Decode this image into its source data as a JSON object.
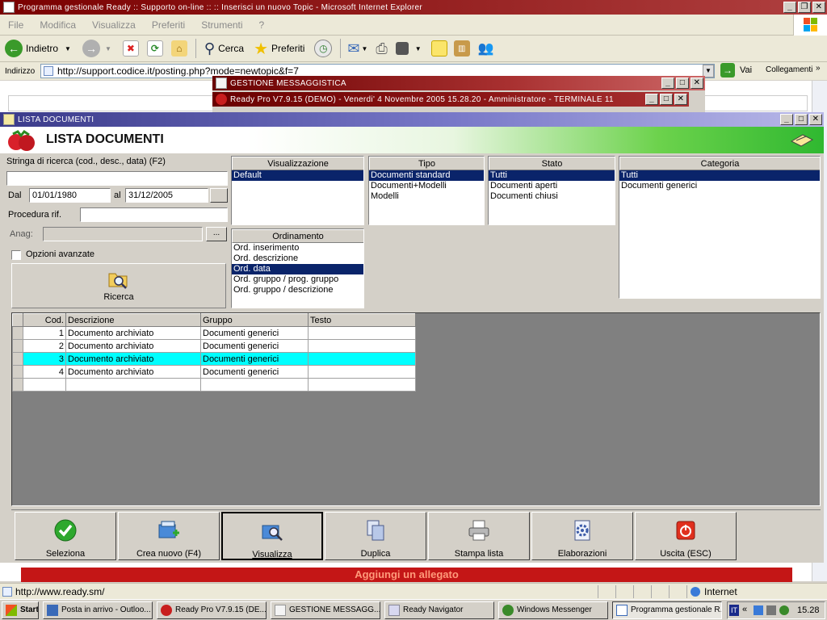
{
  "ie": {
    "title": "Programma gestionale Ready :: Supporto on-line :: :: Inserisci un nuovo Topic - Microsoft Internet Explorer",
    "menu": [
      "File",
      "Modifica",
      "Visualizza",
      "Preferiti",
      "Strumenti",
      "?"
    ],
    "toolbar": {
      "back": "Indietro",
      "search": "Cerca",
      "favorites": "Preferiti"
    },
    "address_label": "Indirizzo",
    "address_url": "http://support.codice.it/posting.php?mode=newtopic&f=7",
    "go_label": "Vai",
    "links_label": "Collegamenti",
    "page_banner": "Aggiungi un allegato",
    "status_url": "http://www.ready.sm/",
    "zone": "Internet"
  },
  "messaging": {
    "title": "GESTIONE MESSAGGISTICA",
    "subtitle": "Ready Pro V7.9.15 (DEMO)  - Venerdi' 4 Novembre 2005  15.28.20 - Amministratore - TERMINALE 11"
  },
  "app": {
    "window_title": "LISTA DOCUMENTI",
    "header_title": "LISTA DOCUMENTI",
    "search_label": "Stringa di ricerca (cod., desc., data) (F2)",
    "search_value": "",
    "dal_label": "Dal",
    "dal_value": "01/01/1980",
    "al_label": "al",
    "al_value": "31/12/2005",
    "procedura_label": "Procedura rif.",
    "procedura_value": "",
    "anag_label": "Anag:",
    "anag_button": "...",
    "advanced_label": "Opzioni avanzate",
    "advanced_checked": false,
    "search_button": "Ricerca",
    "panels": {
      "visualizzazione": {
        "title": "Visualizzazione",
        "items": [
          "Default"
        ],
        "selected": 0
      },
      "tipo": {
        "title": "Tipo",
        "items": [
          "Documenti standard",
          "Documenti+Modelli",
          "Modelli"
        ],
        "selected": 0
      },
      "stato": {
        "title": "Stato",
        "items": [
          "Tutti",
          "Documenti aperti",
          "Documenti chiusi"
        ],
        "selected": 0
      },
      "categoria": {
        "title": "Categoria",
        "items": [
          "Tutti",
          "Documenti generici"
        ],
        "selected": 0
      },
      "ordinamento": {
        "title": "Ordinamento",
        "items": [
          "Ord. inserimento",
          "Ord. descrizione",
          "Ord. data",
          "Ord. gruppo / prog. gruppo",
          "Ord. gruppo / descrizione"
        ],
        "selected": 2
      }
    },
    "grid": {
      "columns": [
        "Cod.",
        "Descrizione",
        "Gruppo",
        "Testo"
      ],
      "rows": [
        [
          "1",
          "Documento archiviato",
          "Documenti generici",
          ""
        ],
        [
          "2",
          "Documento archiviato",
          "Documenti generici",
          ""
        ],
        [
          "3",
          "Documento archiviato",
          "Documenti generici",
          ""
        ],
        [
          "4",
          "Documento archiviato",
          "Documenti generici",
          ""
        ]
      ],
      "highlighted_row": 2
    },
    "buttons": [
      "Seleziona",
      "Crea nuovo (F4)",
      "Visualizza",
      "Duplica",
      "Stampa lista",
      "Elaborazioni",
      "Uscita (ESC)"
    ]
  },
  "taskbar": {
    "start": "Start",
    "tasks": [
      "Posta in arrivo - Outloo...",
      "Ready Pro V7.9.15 (DE...",
      "GESTIONE MESSAGG...",
      "Ready Navigator",
      "Windows Messenger",
      "Programma gestionale R..."
    ],
    "clock": "15.28"
  },
  "colors": {
    "ie_title": "#8e1818",
    "app_title": "#3a3a8a",
    "selection": "#0a246a",
    "row_highlight": "#00ffff",
    "grid_bg": "#808080"
  }
}
